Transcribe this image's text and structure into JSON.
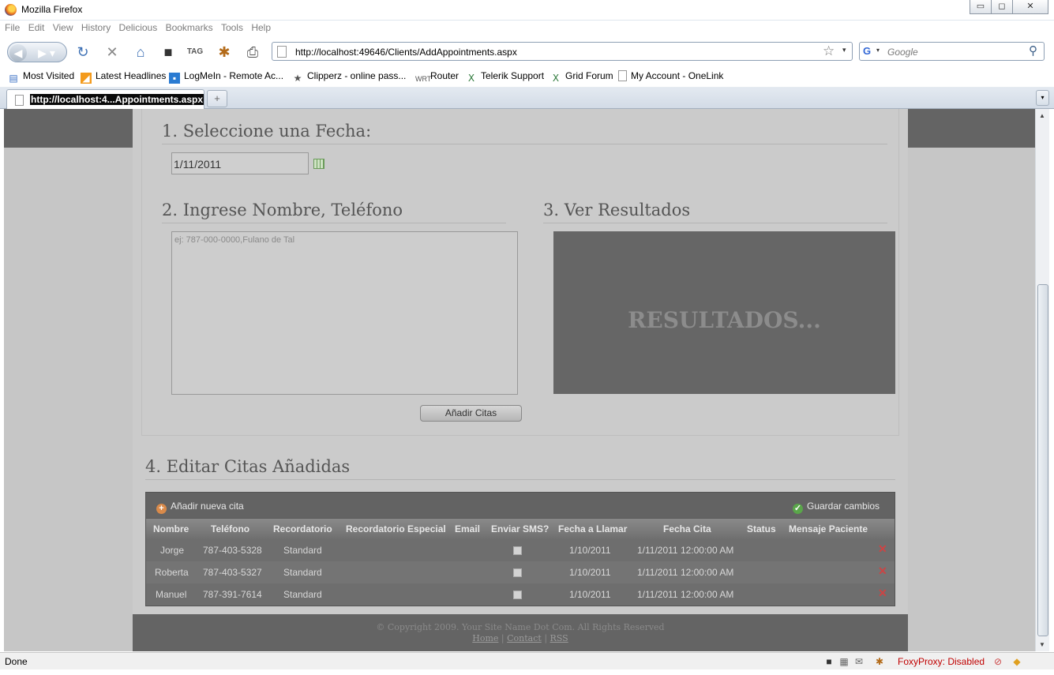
{
  "window": {
    "title": "Mozilla Firefox",
    "min": "▭",
    "max": "◻",
    "close": "✕"
  },
  "menu": {
    "file": "File",
    "edit": "Edit",
    "view": "View",
    "history": "History",
    "delicious": "Delicious",
    "bookmarks": "Bookmarks",
    "tools": "Tools",
    "help": "Help"
  },
  "nav": {
    "url": "http://localhost:49646/Clients/AddAppointments.aspx",
    "search_placeholder": "Google"
  },
  "bookmarks": [
    "Most Visited",
    "Latest Headlines",
    "LogMeIn - Remote Ac...",
    "Clipperz - online pass...",
    "Router",
    "Telerik Support",
    "Grid Forum",
    "My Account - OneLink"
  ],
  "tab": {
    "label": "http://localhost:4...Appointments.aspx"
  },
  "form": {
    "step1": "1. Seleccione una Fecha:",
    "date_value": "1/11/2011",
    "step2": "2. Ingrese Nombre, Teléfono",
    "names_placeholder": "ej: 787-000-0000,Fulano de Tal",
    "step3": "3. Ver Resultados",
    "results_text": "RESULTADOS...",
    "add_button": "Añadir Citas",
    "step4": "4. Editar Citas Añadidas"
  },
  "grid": {
    "add_new": "Añadir nueva cita",
    "save": "Guardar cambios",
    "headers": [
      "Nombre",
      "Teléfono",
      "Recordatorio",
      "Recordatorio Especial",
      "Email",
      "Enviar SMS?",
      "Fecha a Llamar",
      "Fecha Cita",
      "Status",
      "Mensaje Paciente"
    ],
    "rows": [
      {
        "nombre": "Jorge",
        "telefono": "787-403-5328",
        "recordatorio": "Standard",
        "fecha_llamar": "1/10/2011",
        "fecha_cita": "1/11/2011 12:00:00 AM"
      },
      {
        "nombre": "Roberta",
        "telefono": "787-403-5327",
        "recordatorio": "Standard",
        "fecha_llamar": "1/10/2011",
        "fecha_cita": "1/11/2011 12:00:00 AM"
      },
      {
        "nombre": "Manuel",
        "telefono": "787-391-7614",
        "recordatorio": "Standard",
        "fecha_llamar": "1/10/2011",
        "fecha_cita": "1/11/2011 12:00:00 AM"
      }
    ]
  },
  "footer": {
    "copyright": "© Copyright 2009. Your Site Name Dot Com. All Rights Reserved",
    "home": "Home",
    "contact": "Contact",
    "rss": "RSS",
    "sep": "|"
  },
  "status": {
    "text": "Done",
    "foxyproxy": "FoxyProxy: Disabled"
  }
}
